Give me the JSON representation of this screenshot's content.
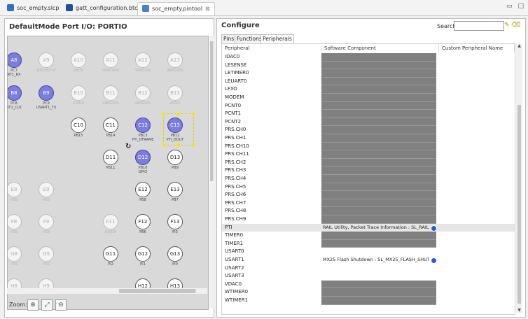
{
  "tabs": [
    {
      "label": "soc_empty.slcp",
      "active": false,
      "icon": "project-icon"
    },
    {
      "label": "gatt_configuration.btconf",
      "active": false,
      "icon": "bluetooth-icon"
    },
    {
      "label": "soc_empty.pintool",
      "active": true,
      "icon": "pintool-icon"
    }
  ],
  "left_panel": {
    "title": "DefaultMode Port I/O: PORTIO",
    "zoom_label": "Zoom:",
    "pins": [
      {
        "id": "A8",
        "label": "PC7",
        "label2": "RT1_RX",
        "state": "sel"
      },
      {
        "id": "A9",
        "label": "DECOUPLE",
        "state": "dim"
      },
      {
        "id": "A10",
        "label": "DVDD",
        "state": "dim"
      },
      {
        "id": "A11",
        "label": "VREGVDD",
        "state": "dim"
      },
      {
        "id": "A12",
        "label": "VREGSW",
        "state": "dim"
      },
      {
        "id": "A13",
        "label": "VREGVSS",
        "state": "dim"
      },
      {
        "id": "B8",
        "label": "PC8",
        "label2": "RT1_CLK",
        "state": "sel"
      },
      {
        "id": "B9",
        "label": "PC9",
        "label2": "USART1_TX",
        "state": "sel"
      },
      {
        "id": "B10",
        "label": "IOVDD",
        "state": "dim"
      },
      {
        "id": "B11",
        "label": "VREGVSS",
        "state": "dim"
      },
      {
        "id": "B12",
        "label": "VREGVSS",
        "state": "dim"
      },
      {
        "id": "B13",
        "label": "AVDD",
        "state": "dim"
      },
      {
        "id": "C10",
        "label": "PB15",
        "state": "dark"
      },
      {
        "id": "C11",
        "label": "PB14",
        "state": "dark"
      },
      {
        "id": "C12",
        "label": "PB13",
        "label2": "PTI_DFRAME",
        "state": "sel"
      },
      {
        "id": "C13",
        "label": "PB12",
        "label2": "PTI_DOUT",
        "state": "sel"
      },
      {
        "id": "D11",
        "label": "PB11",
        "state": "dark"
      },
      {
        "id": "D12",
        "label": "PB10",
        "label2": "GPIO",
        "state": "sel"
      },
      {
        "id": "D13",
        "label": "PB9",
        "state": "dark"
      },
      {
        "id": "E8",
        "label": "VSS",
        "state": "dim"
      },
      {
        "id": "E9",
        "label": "VSS",
        "state": "dim"
      },
      {
        "id": "E12",
        "label": "PB8",
        "state": "dark"
      },
      {
        "id": "E13",
        "label": "PB7",
        "state": "dark"
      },
      {
        "id": "F8",
        "label": "VSS",
        "state": "dim"
      },
      {
        "id": "F9",
        "label": "VSS",
        "state": "dim"
      },
      {
        "id": "F11",
        "label": "IOVDD",
        "state": "dim"
      },
      {
        "id": "F12",
        "label": "PB6",
        "state": "dark"
      },
      {
        "id": "F13",
        "label": "PI3",
        "state": "dark"
      },
      {
        "id": "G8",
        "label": "VSS",
        "state": "dim"
      },
      {
        "id": "G9",
        "label": "VSS",
        "state": "dim"
      },
      {
        "id": "G11",
        "label": "PI2",
        "state": "dark"
      },
      {
        "id": "G12",
        "label": "PI1",
        "state": "dark"
      },
      {
        "id": "G13",
        "label": "PI0",
        "state": "dark"
      },
      {
        "id": "H8",
        "label": "",
        "state": "dim"
      },
      {
        "id": "H9",
        "label": "",
        "state": "dim"
      },
      {
        "id": "H12",
        "label": "",
        "state": "dark"
      },
      {
        "id": "H13",
        "label": "",
        "state": "dark"
      }
    ]
  },
  "right_panel": {
    "title": "Configure",
    "search_label": "Search:",
    "search_value": "",
    "subtabs": [
      "Pins",
      "Functions",
      "Peripherals"
    ],
    "active_subtab": "Peripherals",
    "columns": [
      "Peripheral",
      "Software Component",
      "Custom Peripheral Name"
    ],
    "rows": [
      {
        "name": "IDAC0",
        "component": "",
        "gray": true
      },
      {
        "name": "LESENSE",
        "component": "",
        "gray": true
      },
      {
        "name": "LETIMER0",
        "component": "",
        "gray": true
      },
      {
        "name": "LEUART0",
        "component": "",
        "gray": true
      },
      {
        "name": "LFXO",
        "component": "",
        "gray": true
      },
      {
        "name": "MODEM",
        "component": "",
        "gray": true
      },
      {
        "name": "PCNT0",
        "component": "",
        "gray": true
      },
      {
        "name": "PCNT1",
        "component": "",
        "gray": true
      },
      {
        "name": "PCNT2",
        "component": "",
        "gray": true
      },
      {
        "name": "PRS.CH0",
        "component": "",
        "gray": true
      },
      {
        "name": "PRS.CH1",
        "component": "",
        "gray": true
      },
      {
        "name": "PRS.CH10",
        "component": "",
        "gray": true
      },
      {
        "name": "PRS.CH11",
        "component": "",
        "gray": true
      },
      {
        "name": "PRS.CH2",
        "component": "",
        "gray": true
      },
      {
        "name": "PRS.CH3",
        "component": "",
        "gray": true
      },
      {
        "name": "PRS.CH4",
        "component": "",
        "gray": true
      },
      {
        "name": "PRS.CH5",
        "component": "",
        "gray": true
      },
      {
        "name": "PRS.CH6",
        "component": "",
        "gray": true
      },
      {
        "name": "PRS.CH7",
        "component": "",
        "gray": true
      },
      {
        "name": "PRS.CH8",
        "component": "",
        "gray": true
      },
      {
        "name": "PRS.CH9",
        "component": "",
        "gray": true
      },
      {
        "name": "PTI",
        "component": "RAIL Utility, Packet Trace Information : SL_RAIL_",
        "gray": false,
        "highlight": true,
        "dot": true
      },
      {
        "name": "TIMER0",
        "component": "",
        "gray": true
      },
      {
        "name": "TIMER1",
        "component": "",
        "gray": true
      },
      {
        "name": "USART0",
        "component": "",
        "gray": false
      },
      {
        "name": "USART1",
        "component": "MX25 Flash Shutdown : SL_MX25_FLASH_SHUT.",
        "gray": false,
        "dot": true
      },
      {
        "name": "USART2",
        "component": "",
        "gray": false
      },
      {
        "name": "USART3",
        "component": "",
        "gray": false
      },
      {
        "name": "VDAC0",
        "component": "",
        "gray": true
      },
      {
        "name": "WTIMER0",
        "component": "",
        "gray": true
      },
      {
        "name": "WTIMER1",
        "component": "",
        "gray": true
      }
    ]
  },
  "colors": {
    "selected_pin": "#7d7de0",
    "gray_cell": "#808080",
    "dot": "#2a5bd0"
  }
}
